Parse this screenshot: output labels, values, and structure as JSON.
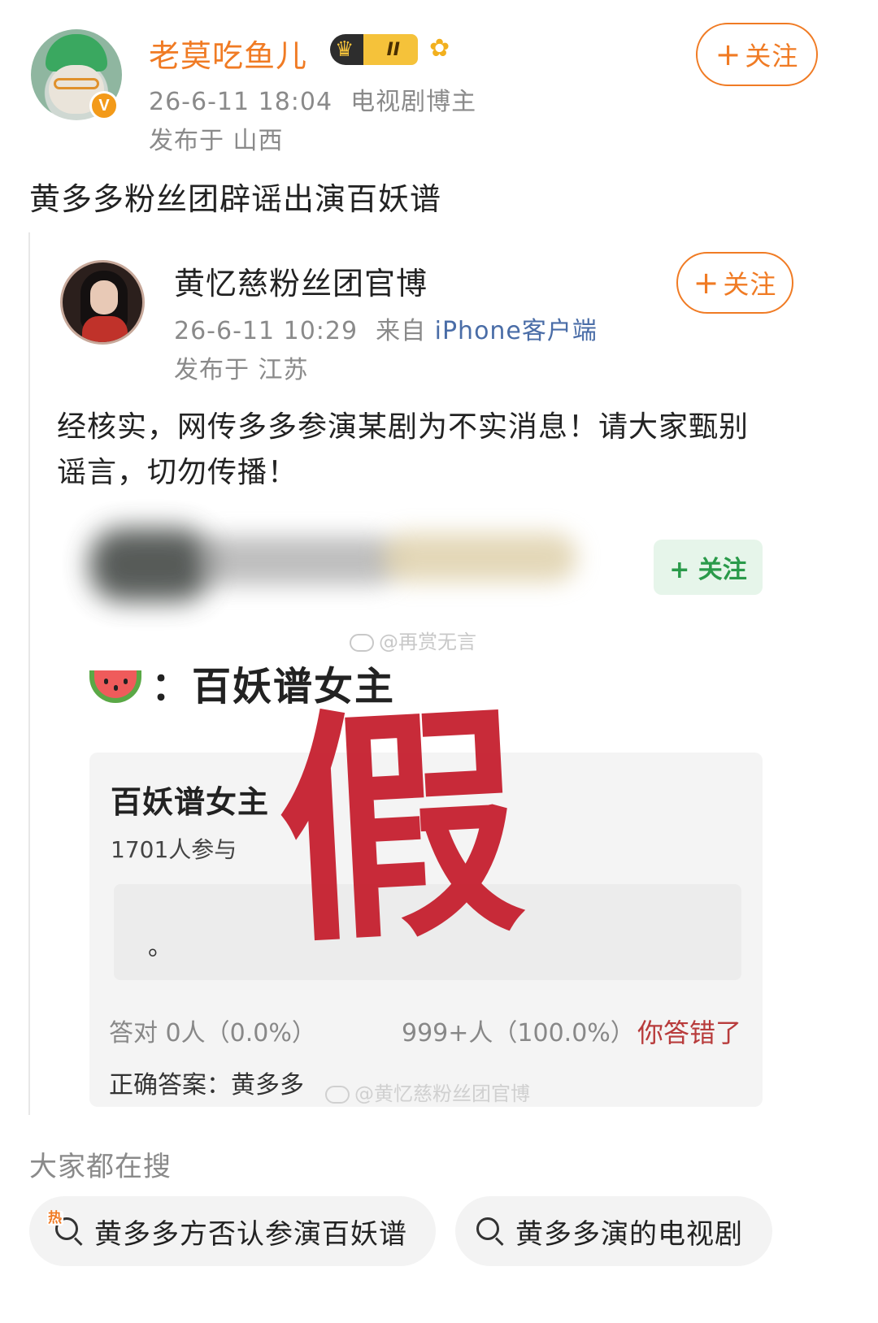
{
  "author": {
    "name": "老莫吃鱼儿",
    "level_badge": "II",
    "datetime": "26-6-11 18:04",
    "role": "电视剧博主",
    "location": "发布于 山西",
    "verified_mark": "V",
    "follow_label": "关注"
  },
  "post": {
    "text": "黄多多粉丝团辟谣出演百妖谱"
  },
  "repost": {
    "author": "黄忆慈粉丝团官博",
    "datetime": "26-6-11 10:29",
    "source_prefix": "来自",
    "source_client": "iPhone客户端",
    "location": "发布于 江苏",
    "follow_label": "关注",
    "text": "经核实，网传多多参演某剧为不实消息！请大家甄别谣言，切勿传播！"
  },
  "embedded": {
    "follow_label": "+ 关注",
    "watermark_top": "@再赏无言",
    "melon_text": "：百妖谱女主",
    "quiz": {
      "title": "百妖谱女主",
      "participants": "1701人参与",
      "option_text": "。",
      "stamp": "假",
      "correct_stats": "答对  0人（0.0%）",
      "wrong_stats": "999+人（100.0%）",
      "result": "你答错了",
      "answer": "正确答案：黄多多",
      "watermark": "@黄忆慈粉丝团官博"
    }
  },
  "search": {
    "label": "大家都在搜",
    "hot_tag": "热",
    "items": [
      "黄多多方否认参演百妖谱",
      "黄多多演的电视剧"
    ]
  },
  "colors": {
    "accent_orange": "#f07b24",
    "client_blue": "#4a6da7",
    "stamp_red": "#c6202f",
    "follow_green": "#2a9a4a"
  },
  "icons": [
    "crown-icon",
    "sunflower-icon",
    "verified-icon",
    "plus-icon",
    "watermelon-icon",
    "weibo-icon",
    "search-icon",
    "hot-icon"
  ]
}
